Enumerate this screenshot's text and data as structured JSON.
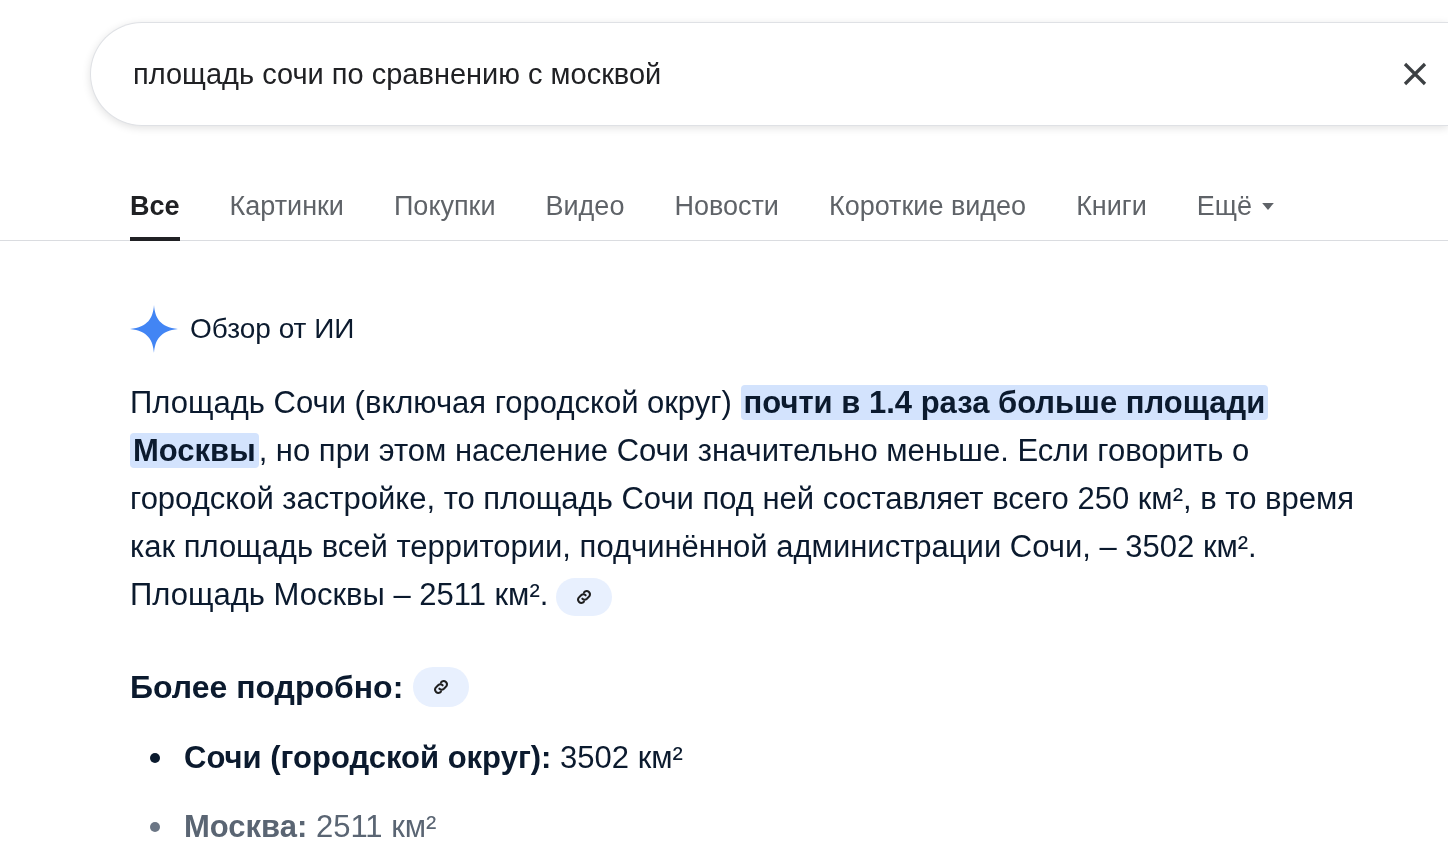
{
  "search": {
    "value": "площадь сочи по сравнению с москвой"
  },
  "tabs": [
    {
      "label": "Все",
      "selected": true
    },
    {
      "label": "Картинки",
      "selected": false
    },
    {
      "label": "Покупки",
      "selected": false
    },
    {
      "label": "Видео",
      "selected": false
    },
    {
      "label": "Новости",
      "selected": false
    },
    {
      "label": "Короткие видео",
      "selected": false
    },
    {
      "label": "Книги",
      "selected": false
    },
    {
      "label": "Ещё",
      "selected": false,
      "dropdown": true
    }
  ],
  "ai_overview": {
    "title": "Обзор от ИИ",
    "paragraph": [
      {
        "text": "Площадь Сочи (включая городской округ) ",
        "highlighted": false
      },
      {
        "text": "почти в 1.4 раза больше площади Москвы",
        "highlighted": true
      },
      {
        "text": ", но при этом население Сочи значительно меньше. Если говорить о городской застройке, то площадь Сочи под ней составляет всего 250 км², в то время как площадь всей территории, подчинённой администрации Сочи, – 3502 км². Площадь Москвы – 2511 км².",
        "highlighted": false
      }
    ],
    "more_heading": "Более подробно:",
    "bullets": [
      {
        "text": "**Сочи (городской округ):** 3502 км²",
        "faded": false
      },
      {
        "text": "**Москва:** 2511 км²",
        "faded": true
      }
    ]
  }
}
